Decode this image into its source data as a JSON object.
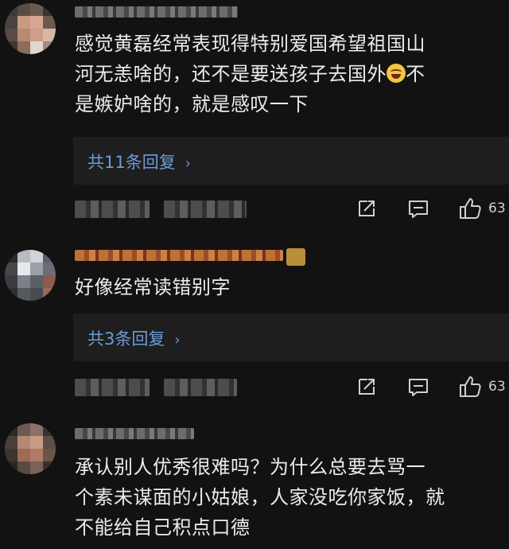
{
  "comments": [
    {
      "text_lines": [
        "感觉黄磊经常表现得特别爱国希望祖国山",
        "河无恙啥的，还不是要送孩子去国外",
        "不",
        "是嫉妒啥的，就是感叹一下"
      ],
      "reply_label": "共11条回复",
      "like_count": "63"
    },
    {
      "text_lines": [
        "好像经常读错别字"
      ],
      "reply_label": "共3条回复",
      "like_count": "63"
    },
    {
      "text_lines": [
        "承认别人优秀很难吗？为什么总要去骂一",
        "个素未谋面的小姑娘，人家没吃你家饭，就",
        "不能给自己积点口德"
      ]
    }
  ],
  "icons": {
    "share": "share-icon",
    "comment": "comment-icon",
    "like": "thumbs-up-icon",
    "emoji": "laughing-crying-emoji",
    "chevron": "chevron-right-icon"
  },
  "colors": {
    "background": "#121212",
    "reply_box": "#1e1e1e",
    "reply_link": "#6d9bd6",
    "text": "#ececec"
  }
}
